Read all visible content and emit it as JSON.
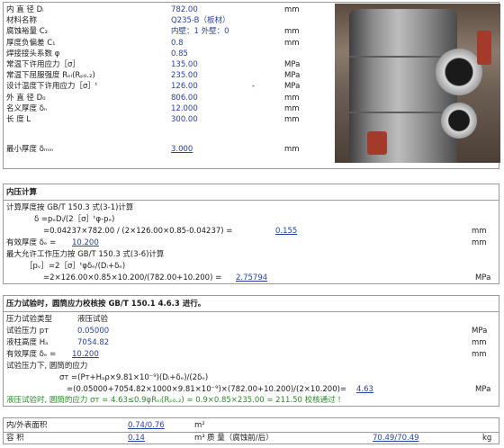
{
  "design": {
    "rows": [
      {
        "label": "内 直 径 Dᵢ",
        "value": "782.00",
        "unit": "mm",
        "mark": ""
      },
      {
        "label": "材料名称",
        "value": "Q235-B（板材）",
        "unit": "",
        "mark": ""
      },
      {
        "label": "腐蚀裕量 C₂",
        "value": "内壁：1  外壁：0",
        "unit": "mm",
        "mark": ""
      },
      {
        "label": "厚度负偏差 C₁",
        "value": "0.8",
        "unit": "mm",
        "mark": ""
      },
      {
        "label": "焊接接头系数 φ",
        "value": "0.85",
        "unit": "",
        "mark": ""
      },
      {
        "label": "常温下许用应力［σ］",
        "value": "135.00",
        "unit": "MPa",
        "mark": ""
      },
      {
        "label": "常温下屈服强度 Rₑₗ(Rₚ₀.₂)",
        "value": "235.00",
        "unit": "MPa",
        "mark": ""
      },
      {
        "label": "设计温度下许用应力［σ］ᵗ",
        "value": "126.00",
        "unit": "MPa",
        "mark": "-"
      },
      {
        "label": "外 直 径 D₀",
        "value": "806.00",
        "unit": "mm",
        "mark": ""
      },
      {
        "label": "名义厚度 δₙ",
        "value": "12.000",
        "unit": "mm",
        "mark": ""
      },
      {
        "label": "长 度 L",
        "value": "300.00",
        "unit": "mm",
        "mark": ""
      }
    ],
    "min_thickness": {
      "label": "最小厚度 δₘᵢₙ",
      "value": "3.000",
      "unit": "mm"
    }
  },
  "internal": {
    "title": "内压计算",
    "basis": "计算厚度按 GB/T 150.3 式(3-1)计算",
    "f1": "δ   =pₑDᵢ/(2［σ］ᵗφ-pₑ)",
    "f2": "=0.04237×782.00 / (2×126.00×0.85-0.04237)  =",
    "f2_result": "0.155",
    "f2_unit": "mm",
    "eff_label": "有效厚度  δₑ =",
    "eff_value": "10.200",
    "eff_unit": "mm",
    "maxp_basis": "最大允许工作压力按 GB/T 150.3 式(3-6)计算",
    "f3": "［pᵥ］=2［σ］ᵗφδₑ/(Dᵢ+δₑ)",
    "f4": "=2×126.00×0.85×10.200/(782.00+10.200) =",
    "f4_result": "2.75794",
    "f4_unit": "MPa"
  },
  "test": {
    "title": "压力试验时，圆筒应力校核按 GB/T 150.1 4.6.3 进行。",
    "type_label": "压力试验类型",
    "type_value": "液压试验",
    "pt_label": "试验压力 pᴛ",
    "pt_value": "0.05000",
    "pt_unit": "MPa",
    "h_label": "液柱高度 Hₐ",
    "h_value": "7054.82",
    "h_unit": "mm",
    "eff_label": "有效厚度  δₑ =",
    "eff_value": "10.200",
    "eff_unit": "mm",
    "stress_label": "试验压力下, 圆筒的应力",
    "s1": "σᴛ =(Pᴛ+Hₐρ×9.81×10⁻⁹)(Dᵢ+δₑ)/(2δₑ)",
    "s2": "=(0.05000+7054.82×1000×9.81×10⁻⁹)×(782.00+10.200)/(2×10.200)=",
    "s2_result": "4.63",
    "s2_unit": "MPa",
    "check": "液压试验时, 圆筒的应力  σᴛ = 4.63≤0.9φRₑₗ(Rₚ₀.₂)  = 0.9×0.85×235.00 = 211.50  校核通过 !"
  },
  "footer": {
    "area_label": "内/外表面积",
    "area_value": "0.74/0.76",
    "area_unit": "m²",
    "vol_label": "容 积",
    "vol_value": "0.14",
    "vol_unit": "m³",
    "mass_label": "质 量（腐蚀前/后）",
    "mass_value": "70.49/70.49",
    "mass_unit": "kg"
  }
}
